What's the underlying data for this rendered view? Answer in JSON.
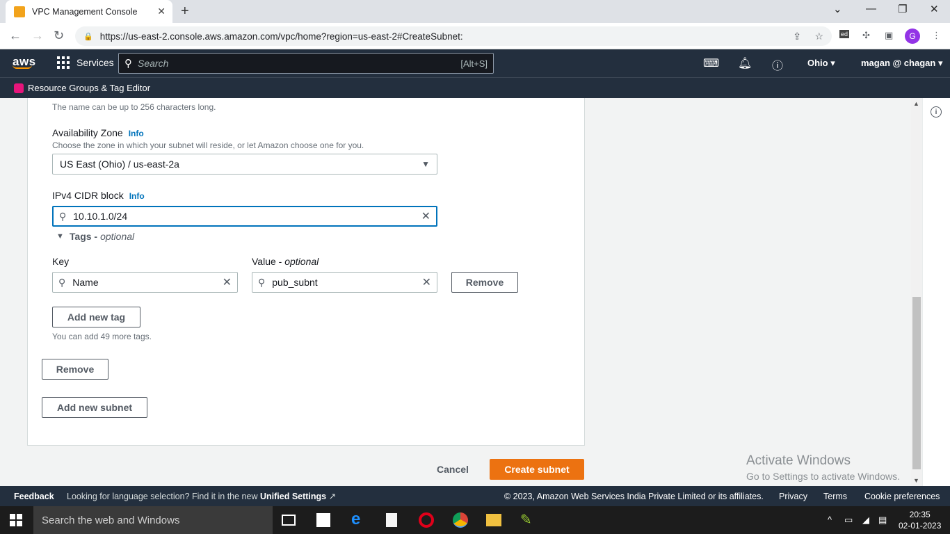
{
  "browser": {
    "tab_title": "VPC Management Console",
    "url": "https://us-east-2.console.aws.amazon.com/vpc/home?region=us-east-2#CreateSubnet:"
  },
  "awsnav": {
    "logo": "aws",
    "services_label": "Services",
    "search_placeholder": "Search",
    "search_shortcut": "[Alt+S]",
    "region": "Ohio",
    "account": "magan @ chagan",
    "resource_groups": "Resource Groups & Tag Editor"
  },
  "form": {
    "name_hint": "The name can be up to 256 characters long.",
    "az_label": "Availability Zone",
    "info": "Info",
    "az_hint": "Choose the zone in which your subnet will reside, or let Amazon choose one for you.",
    "az_value": "US East (Ohio) / us-east-2a",
    "cidr_label": "IPv4 CIDR block",
    "cidr_value": "10.10.1.0/24",
    "tags_label": "Tags -",
    "tags_optional": "optional",
    "key_label": "Key",
    "value_label": "Value -",
    "value_optional": "optional",
    "tag_key": "Name",
    "tag_value": "pub_subnt",
    "remove_tag": "Remove",
    "add_tag": "Add new tag",
    "tags_remaining": "You can add 49 more tags.",
    "remove_subnet": "Remove",
    "add_subnet": "Add new subnet"
  },
  "actions": {
    "cancel": "Cancel",
    "create": "Create subnet"
  },
  "watermark": {
    "line1": "Activate Windows",
    "line2": "Go to Settings to activate Windows."
  },
  "footer": {
    "feedback": "Feedback",
    "lang_text": "Looking for language selection? Find it in the new",
    "lang_link": "Unified Settings",
    "copyright": "© 2023, Amazon Web Services India Private Limited or its affiliates.",
    "privacy": "Privacy",
    "terms": "Terms",
    "cookies": "Cookie preferences"
  },
  "taskbar": {
    "search": "Search the web and Windows",
    "time": "20:35",
    "date": "02-01-2023"
  },
  "colors": {
    "primary_button": "#ec7211",
    "aws_nav": "#232f3e",
    "focus": "#0073bb"
  }
}
